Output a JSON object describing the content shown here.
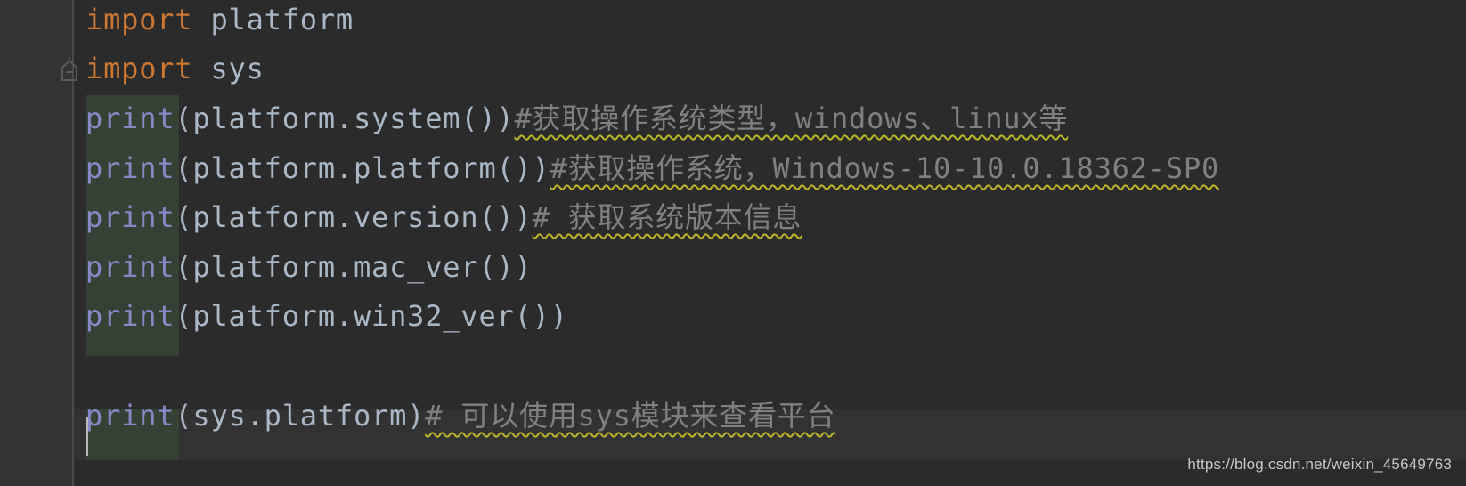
{
  "editor": {
    "language": "python",
    "colors": {
      "background": "#2b2b2b",
      "gutter": "#313335",
      "keyword": "#cc7832",
      "builtin": "#8888c6",
      "identifier": "#a9b7c6",
      "comment": "#808080",
      "typo_underline": "#bbb529",
      "print_highlight": "#344134",
      "current_line": "#323232"
    },
    "lines": [
      {
        "keyword": "import",
        "rest": " platform",
        "comment": ""
      },
      {
        "keyword": "import",
        "rest": " sys",
        "comment": ""
      },
      {
        "builtin": "print",
        "rest": "(platform.system())",
        "comment": "#获取操作系统类型，windows、linux等"
      },
      {
        "builtin": "print",
        "rest": "(platform.platform())",
        "comment": "#获取操作系统，Windows-10-10.0.18362-SP0"
      },
      {
        "builtin": "print",
        "rest": "(platform.version())",
        "comment": "# 获取系统版本信息"
      },
      {
        "builtin": "print",
        "rest": "(platform.mac_ver())",
        "comment": ""
      },
      {
        "builtin": "print",
        "rest": "(platform.win32_ver())",
        "comment": ""
      },
      {
        "builtin": "",
        "rest": "",
        "comment": ""
      },
      {
        "builtin": "print",
        "rest": "(sys.platform)",
        "comment": "# 可以使用sys模块来查看平台"
      }
    ],
    "current_line": 9
  },
  "watermark": "https://blog.csdn.net/weixin_45649763"
}
